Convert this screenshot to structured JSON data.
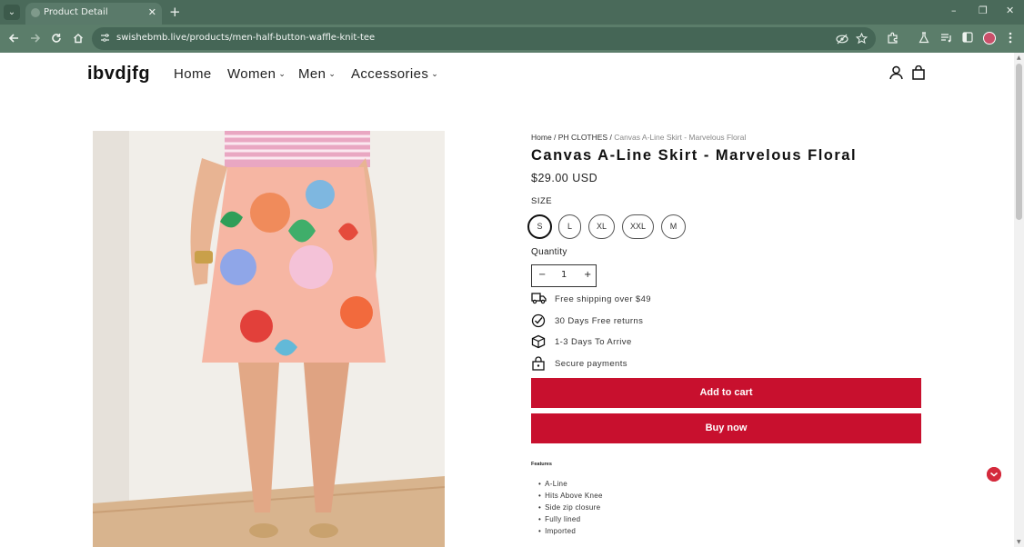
{
  "browser": {
    "tab_title": "Product Detail",
    "tab_close": "✕",
    "new_tab": "+",
    "tab_dropdown": "⌄",
    "url": "swishebmb.live/products/men-half-button-waffle-knit-tee",
    "window_controls": {
      "minimize": "–",
      "restore": "❐",
      "close": "✕"
    }
  },
  "store": {
    "logo": "ibvdjfg",
    "menu": [
      {
        "label": "Home",
        "has_dropdown": false
      },
      {
        "label": "Women",
        "has_dropdown": true
      },
      {
        "label": "Men",
        "has_dropdown": true
      },
      {
        "label": "Accessories",
        "has_dropdown": true
      }
    ],
    "dropdown_glyph": "⌄"
  },
  "product": {
    "breadcrumb": {
      "home": "Home",
      "sep1": " / ",
      "category": "PH CLOTHES",
      "sep2": " / ",
      "current": "Canvas A-Line Skirt - Marvelous Floral"
    },
    "title": "Canvas A-Line Skirt - Marvelous Floral",
    "price": "$29.00 USD",
    "size_label": "SIZE",
    "sizes": [
      "S",
      "L",
      "XL",
      "XXL",
      "M"
    ],
    "selected_size": "S",
    "quantity_label": "Quantity",
    "quantity": "1",
    "qty_minus": "−",
    "qty_plus": "+",
    "perks": [
      {
        "icon": "truck-icon",
        "text": "Free shipping over $49"
      },
      {
        "icon": "check-circle-icon",
        "text": "30 Days Free returns"
      },
      {
        "icon": "box-icon",
        "text": "1-3 Days To Arrive"
      },
      {
        "icon": "lock-icon",
        "text": "Secure payments"
      }
    ],
    "add_to_cart": "Add to cart",
    "buy_now": "Buy now",
    "features_heading": "Features",
    "features": [
      "A-Line",
      "Hits Above Knee",
      "Side zip closure",
      "Fully lined",
      "Imported"
    ]
  },
  "colors": {
    "accent": "#c8102e",
    "browser_frame": "#4a6a5a",
    "toolbar": "#5b7d6a"
  }
}
